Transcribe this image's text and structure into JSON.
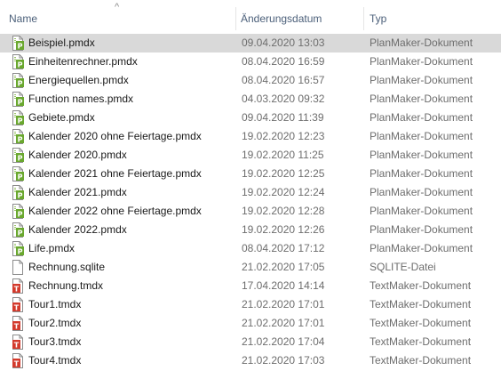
{
  "header": {
    "name_label": "Name",
    "date_label": "Änderungsdatum",
    "type_label": "Typ",
    "sort_arrow": "^"
  },
  "files": [
    {
      "name": "Beispiel.pmdx",
      "date": "09.04.2020 13:03",
      "type": "PlanMaker-Dokument",
      "icon": "planmaker-file-icon",
      "selected": true
    },
    {
      "name": "Einheitenrechner.pmdx",
      "date": "08.04.2020 16:59",
      "type": "PlanMaker-Dokument",
      "icon": "planmaker-file-icon",
      "selected": false
    },
    {
      "name": "Energiequellen.pmdx",
      "date": "08.04.2020 16:57",
      "type": "PlanMaker-Dokument",
      "icon": "planmaker-file-icon",
      "selected": false
    },
    {
      "name": "Function names.pmdx",
      "date": "04.03.2020 09:32",
      "type": "PlanMaker-Dokument",
      "icon": "planmaker-file-icon",
      "selected": false
    },
    {
      "name": "Gebiete.pmdx",
      "date": "09.04.2020 11:39",
      "type": "PlanMaker-Dokument",
      "icon": "planmaker-file-icon",
      "selected": false
    },
    {
      "name": "Kalender 2020 ohne Feiertage.pmdx",
      "date": "19.02.2020 12:23",
      "type": "PlanMaker-Dokument",
      "icon": "planmaker-file-icon",
      "selected": false
    },
    {
      "name": "Kalender 2020.pmdx",
      "date": "19.02.2020 11:25",
      "type": "PlanMaker-Dokument",
      "icon": "planmaker-file-icon",
      "selected": false
    },
    {
      "name": "Kalender 2021 ohne Feiertage.pmdx",
      "date": "19.02.2020 12:25",
      "type": "PlanMaker-Dokument",
      "icon": "planmaker-file-icon",
      "selected": false
    },
    {
      "name": "Kalender 2021.pmdx",
      "date": "19.02.2020 12:24",
      "type": "PlanMaker-Dokument",
      "icon": "planmaker-file-icon",
      "selected": false
    },
    {
      "name": "Kalender 2022 ohne Feiertage.pmdx",
      "date": "19.02.2020 12:28",
      "type": "PlanMaker-Dokument",
      "icon": "planmaker-file-icon",
      "selected": false
    },
    {
      "name": "Kalender 2022.pmdx",
      "date": "19.02.2020 12:26",
      "type": "PlanMaker-Dokument",
      "icon": "planmaker-file-icon",
      "selected": false
    },
    {
      "name": "Life.pmdx",
      "date": "08.04.2020 17:12",
      "type": "PlanMaker-Dokument",
      "icon": "planmaker-file-icon",
      "selected": false
    },
    {
      "name": "Rechnung.sqlite",
      "date": "21.02.2020 17:05",
      "type": "SQLITE-Datei",
      "icon": "generic-file-icon",
      "selected": false
    },
    {
      "name": "Rechnung.tmdx",
      "date": "17.04.2020 14:14",
      "type": "TextMaker-Dokument",
      "icon": "textmaker-file-icon",
      "selected": false
    },
    {
      "name": "Tour1.tmdx",
      "date": "21.02.2020 17:01",
      "type": "TextMaker-Dokument",
      "icon": "textmaker-file-icon",
      "selected": false
    },
    {
      "name": "Tour2.tmdx",
      "date": "21.02.2020 17:01",
      "type": "TextMaker-Dokument",
      "icon": "textmaker-file-icon",
      "selected": false
    },
    {
      "name": "Tour3.tmdx",
      "date": "21.02.2020 17:04",
      "type": "TextMaker-Dokument",
      "icon": "textmaker-file-icon",
      "selected": false
    },
    {
      "name": "Tour4.tmdx",
      "date": "21.02.2020 17:03",
      "type": "TextMaker-Dokument",
      "icon": "textmaker-file-icon",
      "selected": false
    }
  ],
  "icon_badges": {
    "planmaker": "P",
    "textmaker": "T"
  },
  "colors": {
    "planmaker_badge": "#6aa82f",
    "textmaker_badge": "#d33a2c",
    "selection": "#d9d9d9",
    "header_text": "#4c607a"
  }
}
